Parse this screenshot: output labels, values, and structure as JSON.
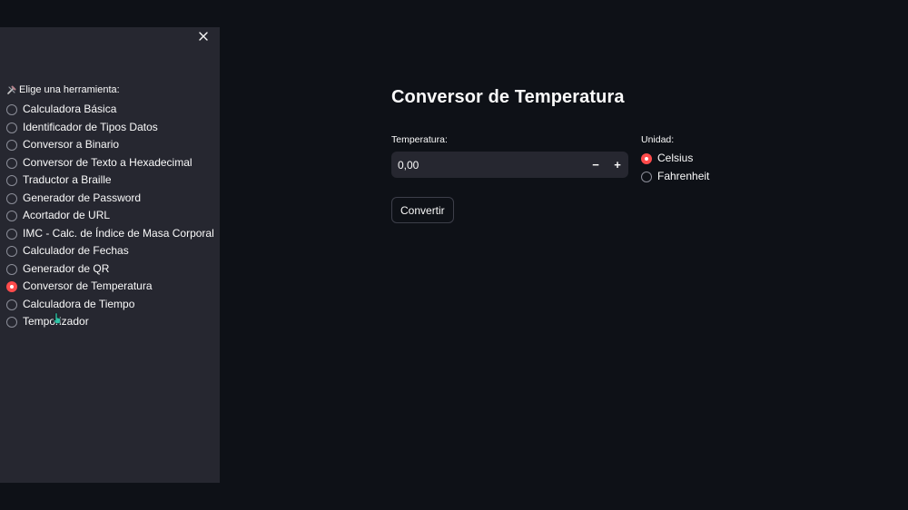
{
  "sidebar": {
    "title": "Elige una herramienta:",
    "title_icon": "tools-icon",
    "close_icon": "close-icon",
    "items": [
      {
        "label": "Calculadora Básica",
        "selected": false
      },
      {
        "label": "Identificador de Tipos Datos",
        "selected": false
      },
      {
        "label": "Conversor a Binario",
        "selected": false
      },
      {
        "label": "Conversor de Texto a Hexadecimal",
        "selected": false
      },
      {
        "label": "Traductor a Braille",
        "selected": false
      },
      {
        "label": "Generador de Password",
        "selected": false
      },
      {
        "label": "Acortador de URL",
        "selected": false
      },
      {
        "label": "IMC - Calc. de Índice de Masa Corporal",
        "selected": false
      },
      {
        "label": "Calculador de Fechas",
        "selected": false
      },
      {
        "label": "Generador de QR",
        "selected": false
      },
      {
        "label": "Conversor de Temperatura",
        "selected": true
      },
      {
        "label": "Calculadora de Tiempo",
        "selected": false
      },
      {
        "label": "Temporizador",
        "selected": false
      }
    ]
  },
  "main": {
    "title": "Conversor de Temperatura",
    "temperature": {
      "label": "Temperatura:",
      "value": "0,00",
      "decrement_label": "−",
      "increment_label": "+"
    },
    "unit": {
      "label": "Unidad:",
      "options": [
        {
          "label": "Celsius",
          "selected": true
        },
        {
          "label": "Fahrenheit",
          "selected": false
        }
      ]
    },
    "convert_label": "Convertir"
  },
  "colors": {
    "background": "#0e1117",
    "sidebar": "#262730",
    "accent": "#ff4b4b",
    "text": "#fafafa"
  }
}
